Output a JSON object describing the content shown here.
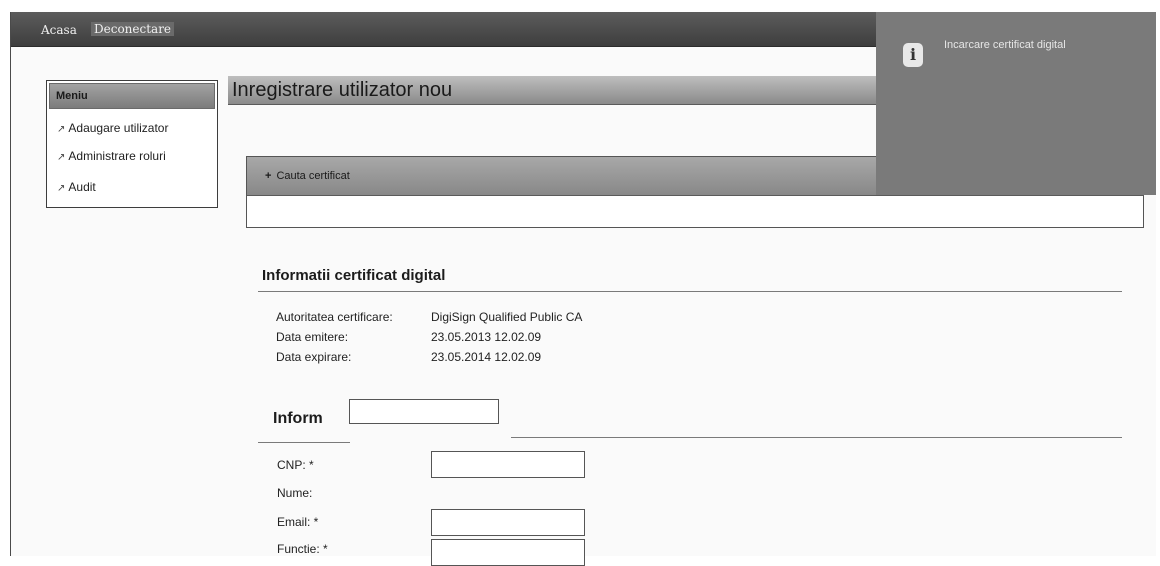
{
  "nav": {
    "home": "Acasa",
    "logout": "Deconectare"
  },
  "menu": {
    "header": "Meniu",
    "items": [
      {
        "label": "Adaugare utilizator",
        "icon": "external-link-icon"
      },
      {
        "label": "Administrare roluri",
        "icon": "external-link-icon"
      },
      {
        "label": "Audit",
        "icon": "external-link-icon"
      }
    ]
  },
  "page": {
    "title": "Inregistrare utilizator nou"
  },
  "search": {
    "label": "Cauta certificat",
    "icon": "plus-icon"
  },
  "notification": {
    "icon": "info-icon",
    "text": "Incarcare certificat digital"
  },
  "certificate": {
    "title": "Informatii certificat digital",
    "fields": [
      {
        "label": "Autoritatea certificare:",
        "value": "DigiSign Qualified Public CA"
      },
      {
        "label": "Data emitere:",
        "value": "23.05.2013 12.02.09"
      },
      {
        "label": "Data expirare:",
        "value": "23.05.2014 12.02.09"
      }
    ]
  },
  "form": {
    "title": "Inform",
    "fields": {
      "cnp": {
        "label": "CNP: *",
        "value": ""
      },
      "nume": {
        "label": "Nume:"
      },
      "email": {
        "label": "Email: *",
        "value": ""
      },
      "functie": {
        "label": "Functie: *",
        "value": ""
      }
    }
  },
  "colors": {
    "topbar": "#4a4a4a",
    "header_gradient_light": "#bebebe",
    "header_gradient_dark": "#8a8a8a",
    "notice_bg": "#7a7a7a"
  }
}
